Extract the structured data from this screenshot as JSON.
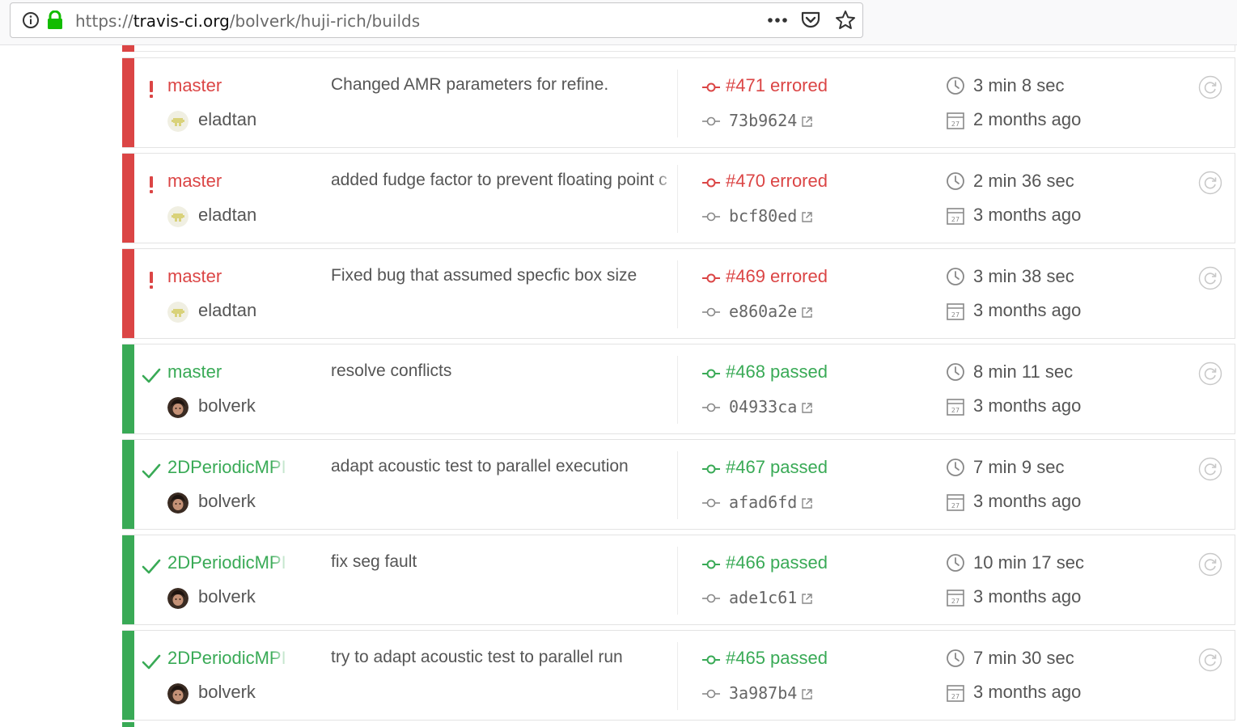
{
  "browser": {
    "url_scheme": "https://",
    "url_host": "travis-ci.org",
    "url_path": "/bolverk/huji-rich/builds",
    "icons": [
      "info-icon",
      "lock-icon",
      "page-actions-icon",
      "pocket-icon",
      "bookmark-star-icon"
    ]
  },
  "colors": {
    "failed": "#db4545",
    "passed": "#39aa56",
    "text": "#555555"
  },
  "builds": [
    {
      "state": "failed",
      "branch": "master",
      "author": "eladtan",
      "avatar": "identicon",
      "message": "Changed AMR parameters for refine.",
      "build_number": "#471 errored",
      "sha": "73b9624",
      "duration": "3 min 8 sec",
      "finished": "2 months ago"
    },
    {
      "state": "failed",
      "branch": "master",
      "author": "eladtan",
      "avatar": "identicon",
      "message": "added fudge factor to prevent floating point c",
      "build_number": "#470 errored",
      "sha": "bcf80ed",
      "duration": "2 min 36 sec",
      "finished": "3 months ago"
    },
    {
      "state": "failed",
      "branch": "master",
      "author": "eladtan",
      "avatar": "identicon",
      "message": "Fixed bug that assumed specfic box size",
      "build_number": "#469 errored",
      "sha": "e860a2e",
      "duration": "3 min 38 sec",
      "finished": "3 months ago"
    },
    {
      "state": "passed",
      "branch": "master",
      "author": "bolverk",
      "avatar": "photo",
      "message": "resolve conflicts",
      "build_number": "#468 passed",
      "sha": "04933ca",
      "duration": "8 min 11 sec",
      "finished": "3 months ago"
    },
    {
      "state": "passed",
      "branch": "2DPeriodicMPI",
      "author": "bolverk",
      "avatar": "photo",
      "message": "adapt acoustic test to parallel execution",
      "build_number": "#467 passed",
      "sha": "afad6fd",
      "duration": "7 min 9 sec",
      "finished": "3 months ago"
    },
    {
      "state": "passed",
      "branch": "2DPeriodicMPI",
      "author": "bolverk",
      "avatar": "photo",
      "message": "fix seg fault",
      "build_number": "#466 passed",
      "sha": "ade1c61",
      "duration": "10 min 17 sec",
      "finished": "3 months ago"
    },
    {
      "state": "passed",
      "branch": "2DPeriodicMPI",
      "author": "bolverk",
      "avatar": "photo",
      "message": "try to adapt acoustic test to parallel run",
      "build_number": "#465 passed",
      "sha": "3a987b4",
      "duration": "7 min 30 sec",
      "finished": "3 months ago"
    }
  ]
}
